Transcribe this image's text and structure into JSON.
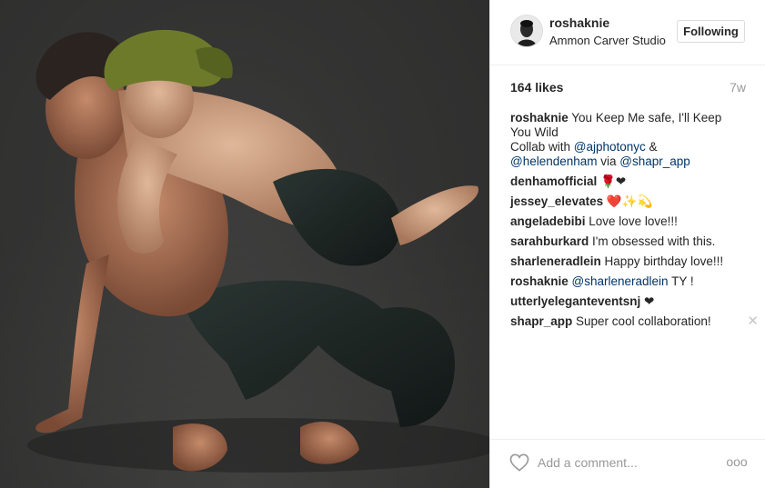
{
  "post": {
    "username": "roshaknie",
    "location": "Ammon Carver Studio",
    "follow_label": "Following",
    "likes": "164 likes",
    "age": "7w",
    "comment_placeholder": "Add a comment...",
    "more_label": "ooo"
  },
  "comments": [
    {
      "user": "roshaknie",
      "text": " You Keep Me safe, I'll Keep You Wild"
    },
    {
      "text": "Collab with ",
      "mention1": "@ajphotonyc",
      "text2": " & "
    },
    {
      "mention2": "@helendenham",
      "text3": " via ",
      "mention3": "@shapr_app"
    },
    {
      "user": "denhamofficial",
      "text": " 🌹❤"
    },
    {
      "user": "jessey_elevates",
      "text": " ❤️✨💫"
    },
    {
      "user": "angeladebibi",
      "text": " Love love love!!!"
    },
    {
      "user": "sarahburkard",
      "text": " I'm obsessed with this."
    },
    {
      "user": "sharleneradlein",
      "text": " Happy birthday love!!!"
    },
    {
      "user": "roshaknie",
      "mention": "@sharleneradlein",
      "text": " TY !"
    },
    {
      "user": "utterlyeleganteventsnj",
      "text": " ❤"
    },
    {
      "user": "shapr_app",
      "text": " Super cool collaboration!",
      "delete_label": "✕"
    }
  ],
  "colors": {
    "mention": "#003569",
    "muted": "#999999",
    "border": "#efefef"
  },
  "icons": {
    "like": "heart-outline-icon",
    "more": "more-options-icon",
    "avatar": "profile-photo"
  }
}
